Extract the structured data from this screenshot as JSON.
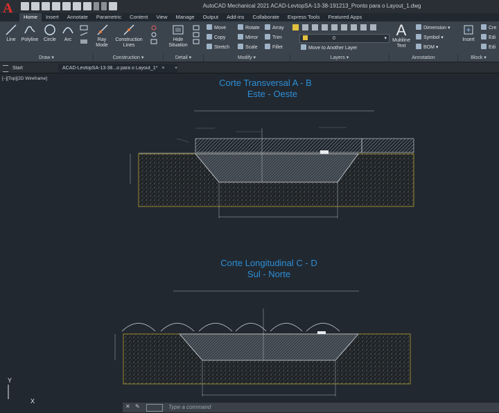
{
  "app": {
    "title": "AutoCAD Mechanical 2021    ACAD-LevtopSA-13-38-191213_Pronto para o Layout_1.dwg",
    "logo": "A"
  },
  "ribbon_tabs": [
    "Home",
    "Insert",
    "Annotate",
    "Parametric",
    "Content",
    "View",
    "Manage",
    "Output",
    "Add-ins",
    "Collaborate",
    "Express Tools",
    "Featured Apps"
  ],
  "draw_tools": {
    "line": "Line",
    "polyline": "Polyline",
    "circle": "Circle",
    "arc": "Arc"
  },
  "construction_tools": {
    "ray": "Ray Mode",
    "construction_lines": "Construction Lines"
  },
  "detail_tools": {
    "hide": "Hide Situation"
  },
  "modify_tools": {
    "move": "Move",
    "rotate": "Rotate",
    "array": "Array",
    "copy": "Copy",
    "mirror": "Mirror",
    "trim": "Trim",
    "stretch": "Stretch",
    "scale": "Scale",
    "fillet": "Fillet"
  },
  "layer_tools": {
    "layer_value": "0",
    "move_layer": "Move to Another Layer"
  },
  "annotation_tools": {
    "multiline": "Multiline Text",
    "dimension": "Dimension",
    "symbol": "Symbol",
    "bom": "BOM"
  },
  "block_tools": {
    "insert": "Insert",
    "create": "Cre",
    "edit": "Edi",
    "edit2": "Edi"
  },
  "panels": {
    "draw": "Draw ▾",
    "construction": "Construction ▾",
    "detail": "Detail ▾",
    "modify": "Modify ▾",
    "layers": "Layers ▾",
    "annotation": "Annotation",
    "block": "Block ▾"
  },
  "doc_tabs": {
    "start": "Start",
    "file": "ACAD-LevtopSA-13-38...o para o Layout_1*",
    "close": "×",
    "add": "+"
  },
  "viewport_label": "[–][Top][2D Wireframe]",
  "drawing": {
    "section1_title": "Corte Transversal A - B",
    "section1_sub": "Este - Oeste",
    "section2_title": "Corte Longitudinal C - D",
    "section2_sub": "Sul - Norte"
  },
  "ucs": {
    "y": "Y",
    "x": "X"
  },
  "command": {
    "placeholder": "Type a command"
  },
  "colors": {
    "accent_blue": "#2e8fd6",
    "ribbon": "#3b434c",
    "canvas": "#212830",
    "soil_outline": "#b8a033"
  }
}
